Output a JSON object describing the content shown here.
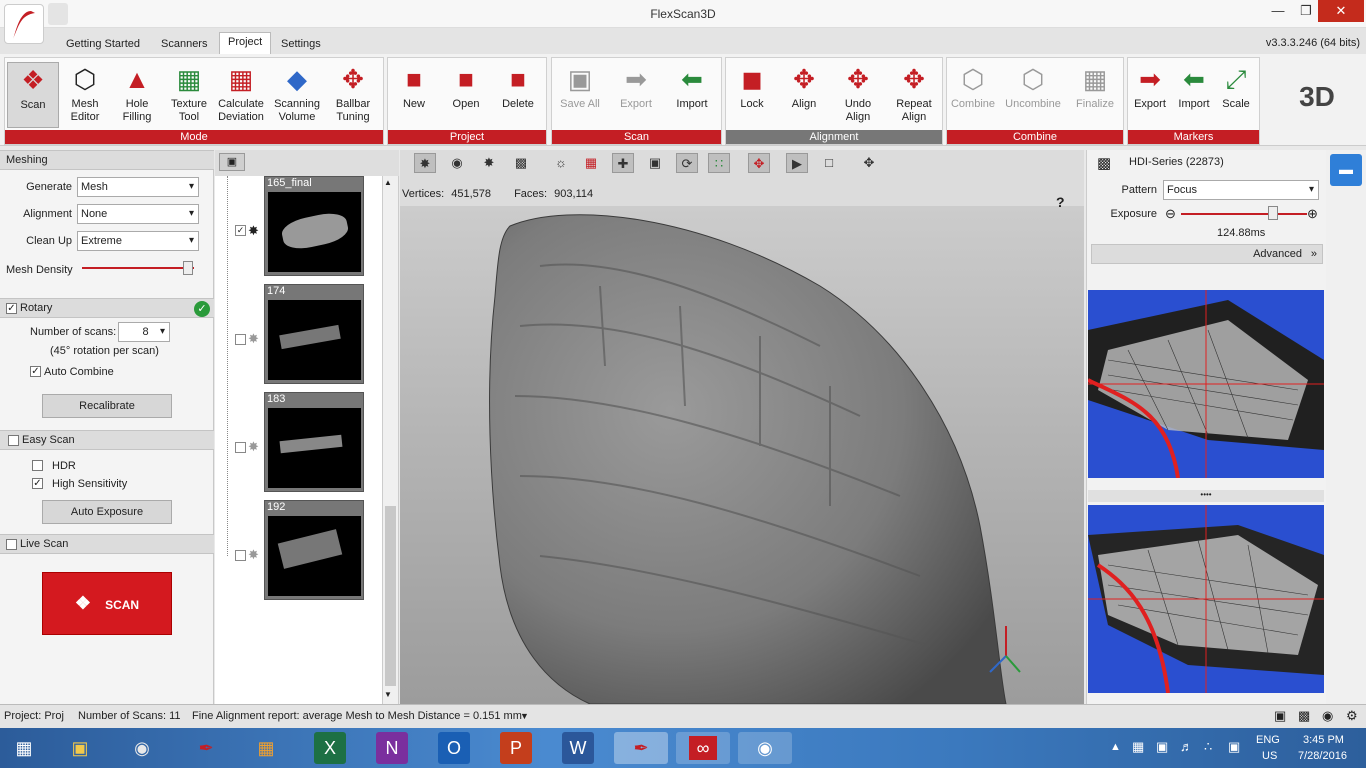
{
  "window": {
    "title": "FlexScan3D",
    "version": "v3.3.3.246  (64 bits)"
  },
  "tabs": [
    "Getting Started",
    "Scanners",
    "Project",
    "Settings"
  ],
  "ribbon": {
    "mode": {
      "label": "Mode",
      "buttons": [
        "Scan",
        "Mesh Editor",
        "Hole Filling",
        "Texture Tool",
        "Calculate Deviation",
        "Scanning Volume",
        "Ballbar Tuning"
      ]
    },
    "project": {
      "label": "Project",
      "buttons": [
        "New",
        "Open",
        "Delete"
      ]
    },
    "scan": {
      "label": "Scan",
      "buttons": [
        "Save All",
        "Export",
        "Import"
      ]
    },
    "alignment": {
      "label": "Alignment",
      "buttons": [
        "Lock",
        "Align",
        "Undo Align",
        "Repeat Align"
      ]
    },
    "combine": {
      "label": "Combine",
      "buttons": [
        "Combine",
        "Uncombine",
        "Finalize"
      ]
    },
    "markers": {
      "label": "Markers",
      "buttons": [
        "Export",
        "Import",
        "Scale"
      ]
    },
    "logo_text": "3D"
  },
  "meshing": {
    "header": "Meshing",
    "generate": {
      "label": "Generate",
      "value": "Mesh"
    },
    "alignment": {
      "label": "Alignment",
      "value": "None"
    },
    "cleanup": {
      "label": "Clean Up",
      "value": "Extreme"
    },
    "density": {
      "label": "Mesh Density",
      "level": 0.95
    }
  },
  "rotary": {
    "header": "Rotary",
    "scans_label": "Number of scans:",
    "scans_value": "8",
    "rotation_note": "(45° rotation per scan)",
    "auto_combine": "Auto Combine",
    "recalibrate": "Recalibrate"
  },
  "easy_scan": {
    "header": "Easy Scan",
    "hdr": "HDR",
    "high_sensitivity": "High Sensitivity",
    "auto_exposure": "Auto Exposure"
  },
  "live_scan": {
    "header": "Live Scan",
    "scan_button": "SCAN"
  },
  "thumbnails": [
    {
      "title": "165_final",
      "checked": true
    },
    {
      "title": "174",
      "checked": false
    },
    {
      "title": "183",
      "checked": false
    },
    {
      "title": "192",
      "checked": false
    }
  ],
  "viewport": {
    "vertices_label": "Vertices:",
    "vertices": "451,578",
    "faces_label": "Faces:",
    "faces": "903,114",
    "help": "?"
  },
  "camera": {
    "title": "HDI-Series (22873)",
    "pattern_label": "Pattern",
    "pattern_value": "Focus",
    "exposure_label": "Exposure",
    "exposure_value": "124.88ms",
    "exposure_level": 0.73,
    "advanced": "Advanced"
  },
  "status": {
    "project": "Project:  Proj",
    "scans": "Number of Scans:  11",
    "report": "Fine Alignment report: average Mesh to Mesh Distance = 0.151 mm"
  },
  "taskbar": {
    "lang1": "ENG",
    "lang2": "US",
    "time": "3:45 PM",
    "date": "7/28/2016"
  }
}
